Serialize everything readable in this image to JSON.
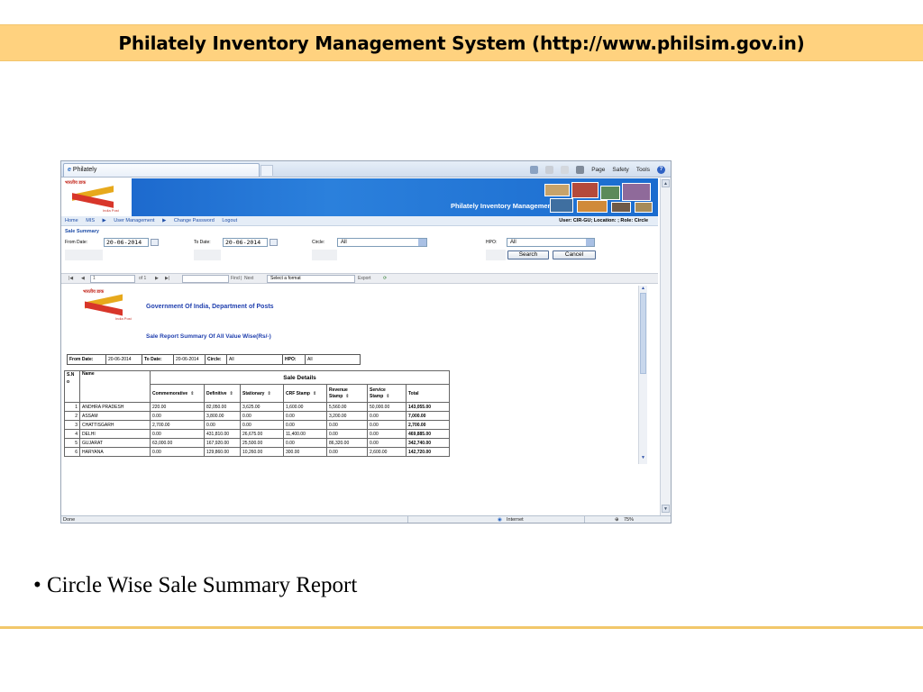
{
  "slide": {
    "title": "Philately Inventory Management System (http://www.philsim.gov.in)",
    "bullet": "• Circle Wise Sale Summary Report"
  },
  "browser": {
    "tab_title": "Philately",
    "commands": [
      "Page",
      "Safety",
      "Tools"
    ],
    "status": "Done",
    "zone": "Internet",
    "zoom": "75%"
  },
  "app": {
    "logo_hindi": "भारतीय डाक",
    "logo_sub": "India Post",
    "banner_title": "Philately Inventory Management",
    "nav": [
      "Home",
      "MIS",
      "User Management",
      "Change Password",
      "Logout"
    ],
    "user_info": "User: CIR-GU; Location: ; Role: Circle",
    "page_title": "Sale Summary",
    "filters": {
      "from_label": "From Date:",
      "from_value": "20-06-2014",
      "to_label": "To Date:",
      "to_value": "20-06-2014",
      "circle_label": "Circle:",
      "circle_value": "All",
      "hpo_label": "HPO:",
      "hpo_value": "All",
      "search": "Search",
      "cancel": "Cancel"
    },
    "viewer": {
      "page_value": "1",
      "of_pages": "of 1",
      "find": "Find",
      "next": "Next",
      "format": "Select a format",
      "export": "Export"
    }
  },
  "report": {
    "logo_hindi": "भारतीय डाक",
    "logo_sub": "India Post",
    "org": "Government Of India, Department of Posts",
    "title": "Sale Report Summary Of All Value Wise(Rs/-)",
    "header": {
      "from_label": "From Date:",
      "from_value": "20-06-2014",
      "to_label": "To Date:",
      "to_value": "20-06-2014",
      "circle_label": "Circle:",
      "circle_value": "All",
      "hpo_label": "HPO:",
      "hpo_value": "All"
    },
    "table": {
      "sno_label": "S.N o",
      "name_label": "Name",
      "group_label": "Sale Details",
      "columns": [
        "Commemorative",
        "Definitive",
        "Stationary",
        "CRF Stamp",
        "Revenue Stamp",
        "Service Stamp",
        "Total"
      ],
      "rows": [
        {
          "sn": "1",
          "name": "ANDHRA PRADESH",
          "v": [
            "220.00",
            "82,050.00",
            "3,625.00",
            "1,600.00",
            "5,560.00",
            "50,000.00",
            "143,055.00"
          ]
        },
        {
          "sn": "2",
          "name": "ASSAM",
          "v": [
            "0.00",
            "3,800.00",
            "0.00",
            "0.00",
            "3,200.00",
            "0.00",
            "7,000.00"
          ]
        },
        {
          "sn": "3",
          "name": "CHATTISGARH",
          "v": [
            "2,700.00",
            "0.00",
            "0.00",
            "0.00",
            "0.00",
            "0.00",
            "2,700.00"
          ]
        },
        {
          "sn": "4",
          "name": "DELHI",
          "v": [
            "0.00",
            "431,810.00",
            "26,675.00",
            "11,400.00",
            "0.00",
            "0.00",
            "469,885.00"
          ]
        },
        {
          "sn": "5",
          "name": "GUJARAT",
          "v": [
            "63,000.00",
            "167,920.00",
            "25,500.00",
            "0.00",
            "86,320.00",
            "0.00",
            "342,740.00"
          ]
        },
        {
          "sn": "6",
          "name": "HARYANA",
          "v": [
            "0.00",
            "129,860.00",
            "10,260.00",
            "300.00",
            "0.00",
            "2,600.00",
            "142,720.00"
          ]
        }
      ]
    }
  }
}
